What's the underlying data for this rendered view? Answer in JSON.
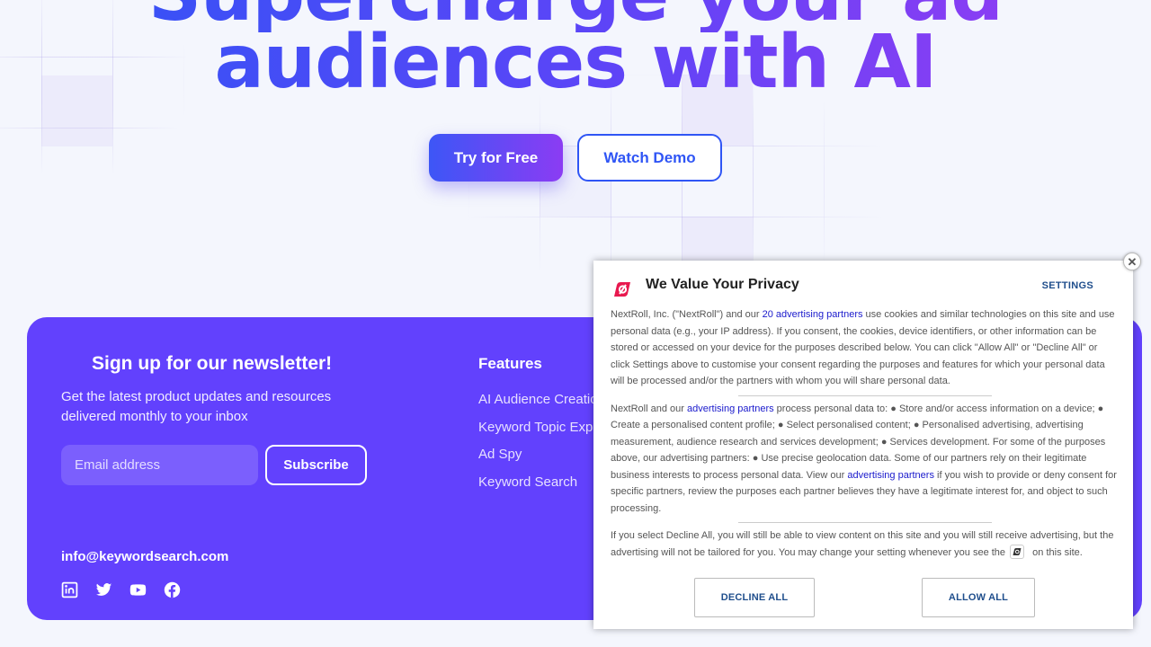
{
  "hero": {
    "title_line1": "Supercharge your ad",
    "title_line2": "audiences with AI",
    "primary_cta": "Try for Free",
    "secondary_cta": "Watch Demo"
  },
  "footer": {
    "newsletter_title": "Sign up for our newsletter!",
    "newsletter_desc": "Get the latest product updates and resources delivered monthly to your inbox",
    "email_placeholder": "Email address",
    "subscribe_label": "Subscribe",
    "contact_email": "info@keywordsearch.com",
    "socials": [
      "linkedin-icon",
      "twitter-icon",
      "youtube-icon",
      "facebook-icon"
    ],
    "features_title": "Features",
    "features": [
      "AI Audience Creation",
      "Keyword Topic Explorer",
      "Ad Spy",
      "Keyword Search"
    ]
  },
  "privacy": {
    "title": "We Value Your Privacy",
    "settings_label": "SETTINGS",
    "close_label": "✕",
    "p1_a": "NextRoll, Inc. (\"NextRoll\") and our ",
    "p1_link": "20 advertising partners",
    "p1_b": " use cookies and similar technologies on this site and use personal data (e.g., your IP address). If you consent, the cookies, device identifiers, or other information can be stored or accessed on your device for the purposes described below. You can click \"Allow All\" or \"Decline All\" or click Settings above to customise your consent regarding the purposes and features for which your personal data will be processed and/or the partners with whom you will share personal data.",
    "p2_a": "NextRoll and our ",
    "p2_link1": "advertising partners",
    "p2_b": " process personal data to: ● Store and/or access information on a device; ● Create a personalised content profile; ● Select personalised content; ● Personalised advertising, advertising measurement, audience research and services development; ● Services development. For some of the purposes above, our advertising partners: ● Use precise geolocation data. Some of our partners rely on their legitimate business interests to process personal data. View our ",
    "p2_link2": "advertising partners",
    "p2_c": " if you wish to provide or deny consent for specific partners, review the purposes each partner believes they have a legitimate interest for, and object to such processing.",
    "p3_a": "If you select Decline All, you will still be able to view content on this site and you will still receive advertising, but the advertising will not be tailored for you. You may change your setting whenever you see the ",
    "p3_b": " on this site.",
    "decline_label": "DECLINE ALL",
    "allow_label": "ALLOW ALL",
    "brand_color": "#e8194f"
  },
  "colors": {
    "accent_blue": "#2f55f5",
    "accent_purple": "#9a3bf2",
    "footer_bg": "#6241fd",
    "link_blue": "#1a1acc"
  }
}
